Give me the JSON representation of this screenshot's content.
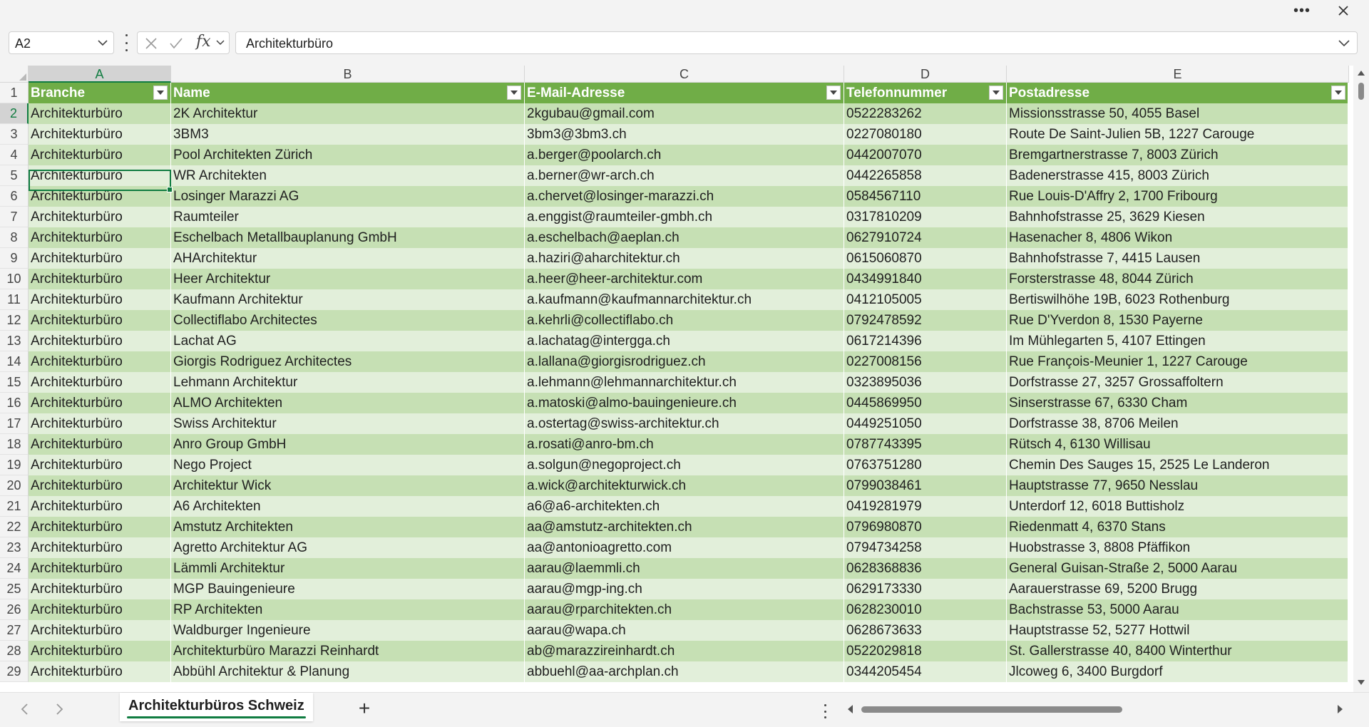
{
  "window": {
    "more_icon": "ellipsis-icon",
    "close_icon": "close-icon"
  },
  "formula_bar": {
    "name_box": "A2",
    "fx_label": "fx",
    "formula": "Architekturbüro"
  },
  "colors": {
    "accent": "#107c41",
    "header_bg": "#70ad47",
    "band_dark": "#c6e0b4",
    "band_light": "#e2efda"
  },
  "columns": [
    "A",
    "B",
    "C",
    "D",
    "E"
  ],
  "active_cell": {
    "column": "A",
    "row": 2
  },
  "table": {
    "headers": [
      "Branche",
      "Name",
      "E-Mail-Adresse",
      "Telefonnummer",
      "Postadresse"
    ],
    "rows": [
      [
        "Architekturbüro",
        "2K Architektur",
        "2kgubau@gmail.com",
        "0522283262",
        "Missionsstrasse 50, 4055 Basel"
      ],
      [
        "Architekturbüro",
        "3BM3",
        "3bm3@3bm3.ch",
        "0227080180",
        "Route De Saint-Julien 5B, 1227 Carouge"
      ],
      [
        "Architekturbüro",
        "Pool Architekten Zürich",
        "a.berger@poolarch.ch",
        "0442007070",
        "Bremgartnerstrasse 7, 8003 Zürich"
      ],
      [
        "Architekturbüro",
        "WR Architekten",
        "a.berner@wr-arch.ch",
        "0442265858",
        "Badenerstrasse 415, 8003 Zürich"
      ],
      [
        "Architekturbüro",
        "Losinger Marazzi AG",
        "a.chervet@losinger-marazzi.ch",
        "0584567110",
        "Rue Louis-D'Affry 2, 1700 Fribourg"
      ],
      [
        "Architekturbüro",
        "Raumteiler",
        "a.enggist@raumteiler-gmbh.ch",
        "0317810209",
        "Bahnhofstrasse 25, 3629 Kiesen"
      ],
      [
        "Architekturbüro",
        "Eschelbach Metallbauplanung GmbH",
        "a.eschelbach@aeplan.ch",
        "0627910724",
        "Hasenacher 8, 4806 Wikon"
      ],
      [
        "Architekturbüro",
        "AHArchitektur",
        "a.haziri@aharchitektur.ch",
        "0615060870",
        "Bahnhofstrasse 7, 4415 Lausen"
      ],
      [
        "Architekturbüro",
        "Heer Architektur",
        "a.heer@heer-architektur.com",
        "0434991840",
        "Forsterstrasse 48, 8044 Zürich"
      ],
      [
        "Architekturbüro",
        "Kaufmann Architektur",
        "a.kaufmann@kaufmannarchitektur.ch",
        "0412105005",
        "Bertiswilhöhe 19B, 6023 Rothenburg"
      ],
      [
        "Architekturbüro",
        "Collectiflabo Architectes",
        "a.kehrli@collectiflabo.ch",
        "0792478592",
        "Rue D'Yverdon 8, 1530 Payerne"
      ],
      [
        "Architekturbüro",
        "Lachat AG",
        "a.lachatag@intergga.ch",
        "0617214396",
        "Im Mühlegarten 5, 4107 Ettingen"
      ],
      [
        "Architekturbüro",
        "Giorgis Rodriguez Architectes",
        "a.lallana@giorgisrodriguez.ch",
        "0227008156",
        "Rue François-Meunier 1, 1227 Carouge"
      ],
      [
        "Architekturbüro",
        "Lehmann Architektur",
        "a.lehmann@lehmannarchitektur.ch",
        "0323895036",
        "Dorfstrasse 27, 3257 Grossaffoltern"
      ],
      [
        "Architekturbüro",
        "ALMO Architekten",
        "a.matoski@almo-bauingenieure.ch",
        "0445869950",
        "Sinserstrasse 67, 6330 Cham"
      ],
      [
        "Architekturbüro",
        "Swiss Architektur",
        "a.ostertag@swiss-architektur.ch",
        "0449251050",
        "Dorfstrasse 38, 8706 Meilen"
      ],
      [
        "Architekturbüro",
        "Anro Group GmbH",
        "a.rosati@anro-bm.ch",
        "0787743395",
        "Rütsch 4, 6130 Willisau"
      ],
      [
        "Architekturbüro",
        "Nego Project",
        "a.solgun@negoproject.ch",
        "0763751280",
        "Chemin Des Sauges 15, 2525 Le Landeron"
      ],
      [
        "Architekturbüro",
        "Architektur Wick",
        "a.wick@architekturwick.ch",
        "0799038461",
        "Hauptstrasse 77, 9650 Nesslau"
      ],
      [
        "Architekturbüro",
        "A6 Architekten",
        "a6@a6-architekten.ch",
        "0419281979",
        "Unterdorf 12, 6018 Buttisholz"
      ],
      [
        "Architekturbüro",
        "Amstutz Architekten",
        "aa@amstutz-architekten.ch",
        "0796980870",
        "Riedenmatt 4, 6370 Stans"
      ],
      [
        "Architekturbüro",
        "Agretto Architektur AG",
        "aa@antonioagretto.com",
        "0794734258",
        "Huobstrasse 3, 8808 Pfäffikon"
      ],
      [
        "Architekturbüro",
        "Lämmli Architektur",
        "aarau@laemmli.ch",
        "0628368836",
        "General Guisan-Straße 2, 5000 Aarau"
      ],
      [
        "Architekturbüro",
        "MGP Bauingenieure",
        "aarau@mgp-ing.ch",
        "0629173330",
        "Aarauerstrasse 69, 5200 Brugg"
      ],
      [
        "Architekturbüro",
        "RP Architekten",
        "aarau@rparchitekten.ch",
        "0628230010",
        "Bachstrasse 53, 5000 Aarau"
      ],
      [
        "Architekturbüro",
        "Waldburger Ingenieure",
        "aarau@wapa.ch",
        "0628673633",
        "Hauptstrasse 52, 5277 Hottwil"
      ],
      [
        "Architekturbüro",
        "Architekturbüro Marazzi Reinhardt",
        "ab@marazzireinhardt.ch",
        "0522029818",
        "St. Gallerstrasse 40, 8400 Winterthur"
      ],
      [
        "Architekturbüro",
        "Abbühl Architektur & Planung",
        "abbuehl@aa-archplan.ch",
        "0344205454",
        "Jlcoweg 6, 3400 Burgdorf"
      ]
    ]
  },
  "sheets": {
    "tabs": [
      {
        "label": "Architekturbüros Schweiz",
        "active": true
      }
    ],
    "add_label": "+"
  }
}
